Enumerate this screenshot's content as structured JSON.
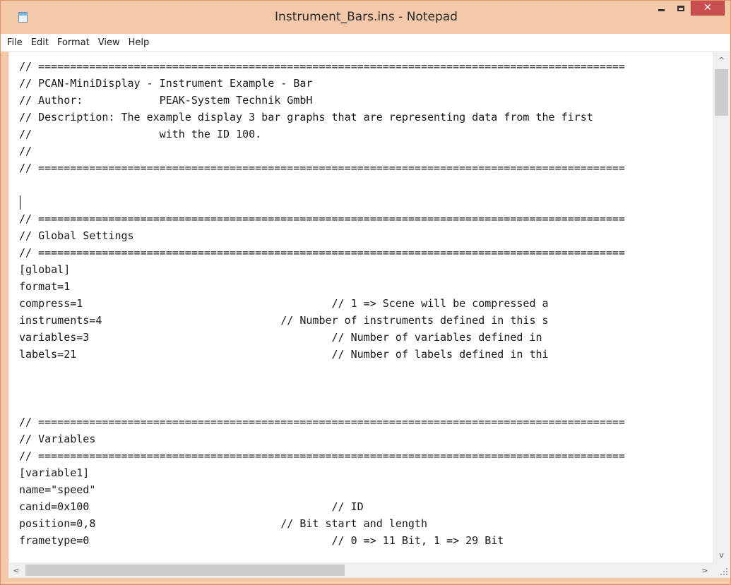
{
  "window": {
    "title": "Instrument_Bars.ins - Notepad",
    "colors": {
      "frame": "#f3c9a9",
      "close_button": "#c74f50",
      "text": "#1a1a1a"
    }
  },
  "titlebar": {
    "app_icon": "notepad-icon",
    "minimize_icon": "minimize-icon",
    "maximize_icon": "maximize-icon",
    "close_icon": "close-icon",
    "close_glyph": "✕"
  },
  "menu": {
    "items": [
      "File",
      "Edit",
      "Format",
      "View",
      "Help"
    ]
  },
  "editor": {
    "lines": [
      "// ============================================================================================",
      "// PCAN-MiniDisplay - Instrument Example - Bar",
      "// Author:            PEAK-System Technik GmbH",
      "// Description: The example display 3 bar graphs that are representing data from the first",
      "//                    with the ID 100.",
      "//",
      "// ============================================================================================",
      "",
      "",
      "// ============================================================================================",
      "// Global Settings",
      "// ============================================================================================",
      "[global]",
      "format=1",
      "compress=1                                       // 1 => Scene will be compressed a",
      "instruments=4                            // Number of instruments defined in this s",
      "variables=3                                      // Number of variables defined in",
      "labels=21                                        // Number of labels defined in thi",
      "",
      "",
      "",
      "// ============================================================================================",
      "// Variables",
      "// ============================================================================================",
      "[variable1]",
      "name=\"speed\"",
      "canid=0x100                                      // ID",
      "position=0,8                             // Bit start and length",
      "frametype=0                                      // 0 => 11 Bit, 1 => 29 Bit"
    ]
  },
  "scrollbars": {
    "up_arrow": "^",
    "down_arrow": "v",
    "left_arrow": "<",
    "right_arrow": ">"
  }
}
